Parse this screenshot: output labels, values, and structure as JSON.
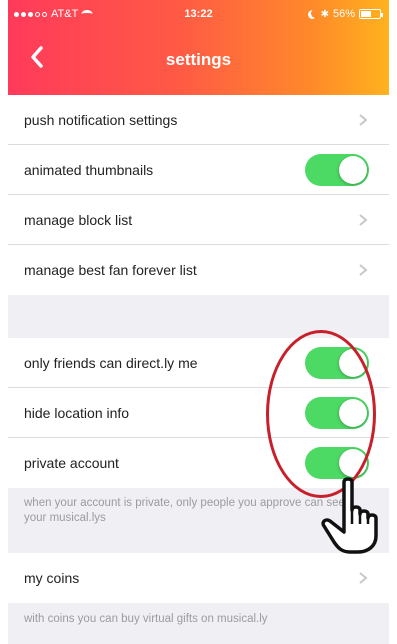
{
  "status_bar": {
    "carrier": "AT&T",
    "time": "13:22",
    "battery": "56%",
    "battery_level": 0.56
  },
  "nav": {
    "title": "settings",
    "back_icon": "chevron-left-icon"
  },
  "section1": {
    "items": [
      {
        "label": "push notification settings",
        "control": "chevron"
      },
      {
        "label": "animated thumbnails",
        "control": "toggle",
        "on": true
      },
      {
        "label": "manage block list",
        "control": "chevron"
      },
      {
        "label": "manage best fan forever list",
        "control": "chevron"
      }
    ]
  },
  "section2": {
    "items": [
      {
        "label": "only friends can direct.ly me",
        "control": "toggle",
        "on": true
      },
      {
        "label": "hide location info",
        "control": "toggle",
        "on": true
      },
      {
        "label": "private account",
        "control": "toggle",
        "on": true
      }
    ],
    "footer": "when your account is private, only people you approve can see your musical.lys"
  },
  "section3": {
    "items": [
      {
        "label": "my coins",
        "control": "chevron"
      }
    ],
    "footer": "with coins you can buy virtual gifts on musical.ly"
  },
  "colors": {
    "header_start": "#ff3a5a",
    "header_end": "#ffb21e",
    "toggle_on": "#4cd964",
    "annotation": "#c8202a"
  },
  "annotation_icon": "pointing-hand-icon"
}
